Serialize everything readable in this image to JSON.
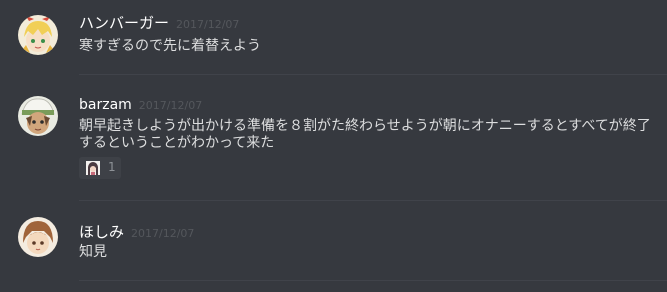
{
  "messages": [
    {
      "username": "ハンバーガー",
      "timestamp": "2017/12/07",
      "content": "寒すぎるので先に着替えよう"
    },
    {
      "username": "barzam",
      "timestamp": "2017/12/07",
      "content": "朝早起きしようが出かける準備を８割がた終わらせようが朝にオナニーするとすべてが終了するということがわかって来た",
      "reaction": {
        "emoji_icon": "character-emoji-icon",
        "count": "1"
      }
    },
    {
      "username": "ほしみ",
      "timestamp": "2017/12/07",
      "content": "知見"
    }
  ],
  "colors": {
    "background": "#36393f",
    "username": "#ffffff",
    "message_text": "#dcddde",
    "timestamp": "#54575c",
    "divider": "#40434a",
    "reaction_bg": "#3e4147"
  }
}
